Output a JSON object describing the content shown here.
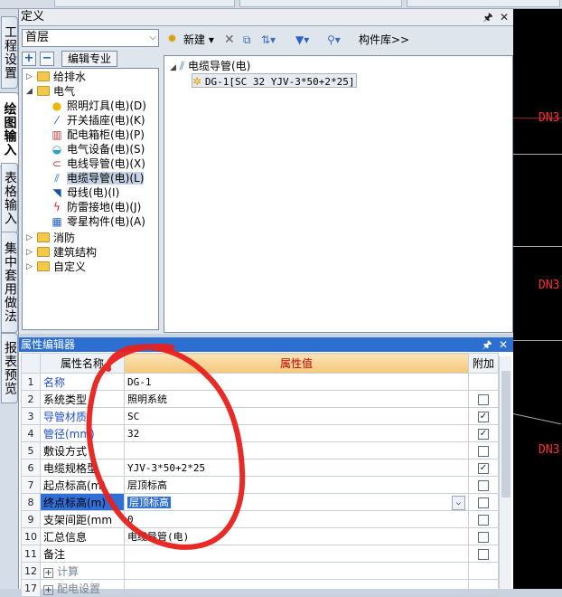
{
  "side_tabs": [
    {
      "label": "工程设置"
    },
    {
      "label": "绘图输入"
    },
    {
      "label": "表格输入"
    },
    {
      "label": "集中套用做法"
    },
    {
      "label": "报表预览"
    }
  ],
  "definition_panel": {
    "title": "定义",
    "floor_selected": "首层",
    "edit_spec_label": "编辑专业",
    "tree": [
      {
        "label": "给排水",
        "type": "folder"
      },
      {
        "label": "电气",
        "type": "folder"
      },
      {
        "label": "照明灯具(电)(D)",
        "icon": "bulb-icon"
      },
      {
        "label": "开关插座(电)(K)",
        "icon": "switch-icon"
      },
      {
        "label": "配电箱柜(电)(P)",
        "icon": "distribution-box-icon"
      },
      {
        "label": "电气设备(电)(S)",
        "icon": "equipment-icon"
      },
      {
        "label": "电线导管(电)(X)",
        "icon": "wire-conduit-icon"
      },
      {
        "label": "电缆导管(电)(L)",
        "icon": "cable-conduit-icon"
      },
      {
        "label": "母线(电)(I)",
        "icon": "busbar-icon"
      },
      {
        "label": "防雷接地(电)(J)",
        "icon": "lightning-icon"
      },
      {
        "label": "零星构件(电)(A)",
        "icon": "component-icon"
      },
      {
        "label": "消防",
        "type": "folder"
      },
      {
        "label": "建筑结构",
        "type": "folder"
      },
      {
        "label": "自定义",
        "type": "folder"
      }
    ],
    "toolbar": {
      "new_label": "新建",
      "library_label": "构件库>>"
    },
    "component_tree": {
      "parent": "电缆导管(电)",
      "child": "DG-1[SC 32 YJV-3*50+2*25]"
    }
  },
  "cad": {
    "labels": [
      "DN3",
      "DN3",
      "DN3"
    ]
  },
  "property_editor": {
    "title": "属性编辑器",
    "columns": {
      "name": "属性名称",
      "value": "属性值",
      "add": "附加"
    },
    "rows": [
      {
        "num": "1",
        "name": "名称",
        "value": "DG-1",
        "blue": true,
        "checkbox": false,
        "checked": false
      },
      {
        "num": "2",
        "name": "系统类型",
        "value": "照明系统",
        "blue": false,
        "checkbox": true,
        "checked": false
      },
      {
        "num": "3",
        "name": "导管材质",
        "value": "SC",
        "blue": true,
        "checkbox": true,
        "checked": true
      },
      {
        "num": "4",
        "name": "管径(mm)",
        "value": "32",
        "blue": true,
        "checkbox": true,
        "checked": true
      },
      {
        "num": "5",
        "name": "敷设方式",
        "value": "",
        "blue": false,
        "checkbox": true,
        "checked": false
      },
      {
        "num": "6",
        "name": "电缆规格型",
        "value": "YJV-3*50+2*25",
        "blue": false,
        "checkbox": true,
        "checked": true
      },
      {
        "num": "7",
        "name": "起点标高(m)",
        "value": "层顶标高",
        "blue": false,
        "checkbox": true,
        "checked": false
      },
      {
        "num": "8",
        "name": "终点标高(m)",
        "value": "层顶标高",
        "blue": false,
        "checkbox": true,
        "checked": false,
        "selected": true
      },
      {
        "num": "9",
        "name": "支架间距(mm",
        "value": "0",
        "blue": false,
        "checkbox": true,
        "checked": false
      },
      {
        "num": "10",
        "name": "汇总信息",
        "value": "电缆导管(电)",
        "blue": false,
        "checkbox": true,
        "checked": false
      },
      {
        "num": "11",
        "name": "备注",
        "value": "",
        "blue": false,
        "checkbox": true,
        "checked": false
      },
      {
        "num": "12",
        "name": "计算",
        "value": "",
        "blue": false,
        "checkbox": false,
        "checked": false,
        "group": true
      },
      {
        "num": "17",
        "name": "配电设置",
        "value": "",
        "blue": false,
        "checkbox": false,
        "checked": false,
        "group": true
      }
    ]
  },
  "colors": {
    "annotation": "#e8201c",
    "cad_label": "#ff2a2a",
    "selection_blue": "#2f6fd6"
  }
}
